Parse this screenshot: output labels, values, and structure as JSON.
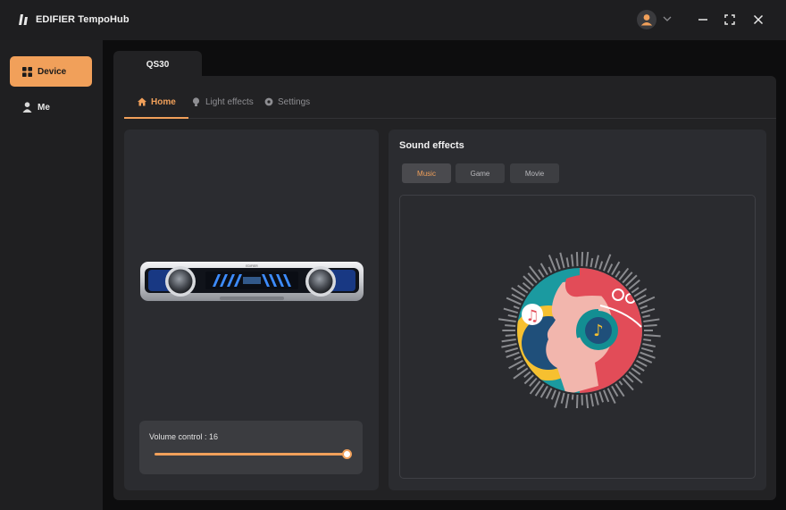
{
  "app": {
    "title": "EDIFIER TempoHub",
    "accent": "#f1a05a"
  },
  "window": {
    "controls": [
      "minimize-icon",
      "maximize-icon",
      "close-icon"
    ]
  },
  "sidebar": {
    "items": [
      {
        "label": "Device",
        "icon": "grid-icon",
        "active": true
      },
      {
        "label": "Me",
        "icon": "person-icon",
        "active": false
      }
    ]
  },
  "device_tab": {
    "label": "QS30"
  },
  "subtabs": [
    {
      "label": "Home",
      "icon": "home-icon",
      "active": true
    },
    {
      "label": "Light effects",
      "icon": "bulb-icon",
      "active": false
    },
    {
      "label": "Settings",
      "icon": "gear-icon",
      "active": false
    }
  ],
  "device": {
    "speaker_brand": "EDIFIER",
    "volume": {
      "label": "Volume control : 16",
      "fraction": 1.0
    }
  },
  "sound_effects": {
    "title": "Sound effects",
    "modes": [
      {
        "label": "Music",
        "active": true
      },
      {
        "label": "Game",
        "active": false
      },
      {
        "label": "Movie",
        "active": false
      }
    ]
  }
}
